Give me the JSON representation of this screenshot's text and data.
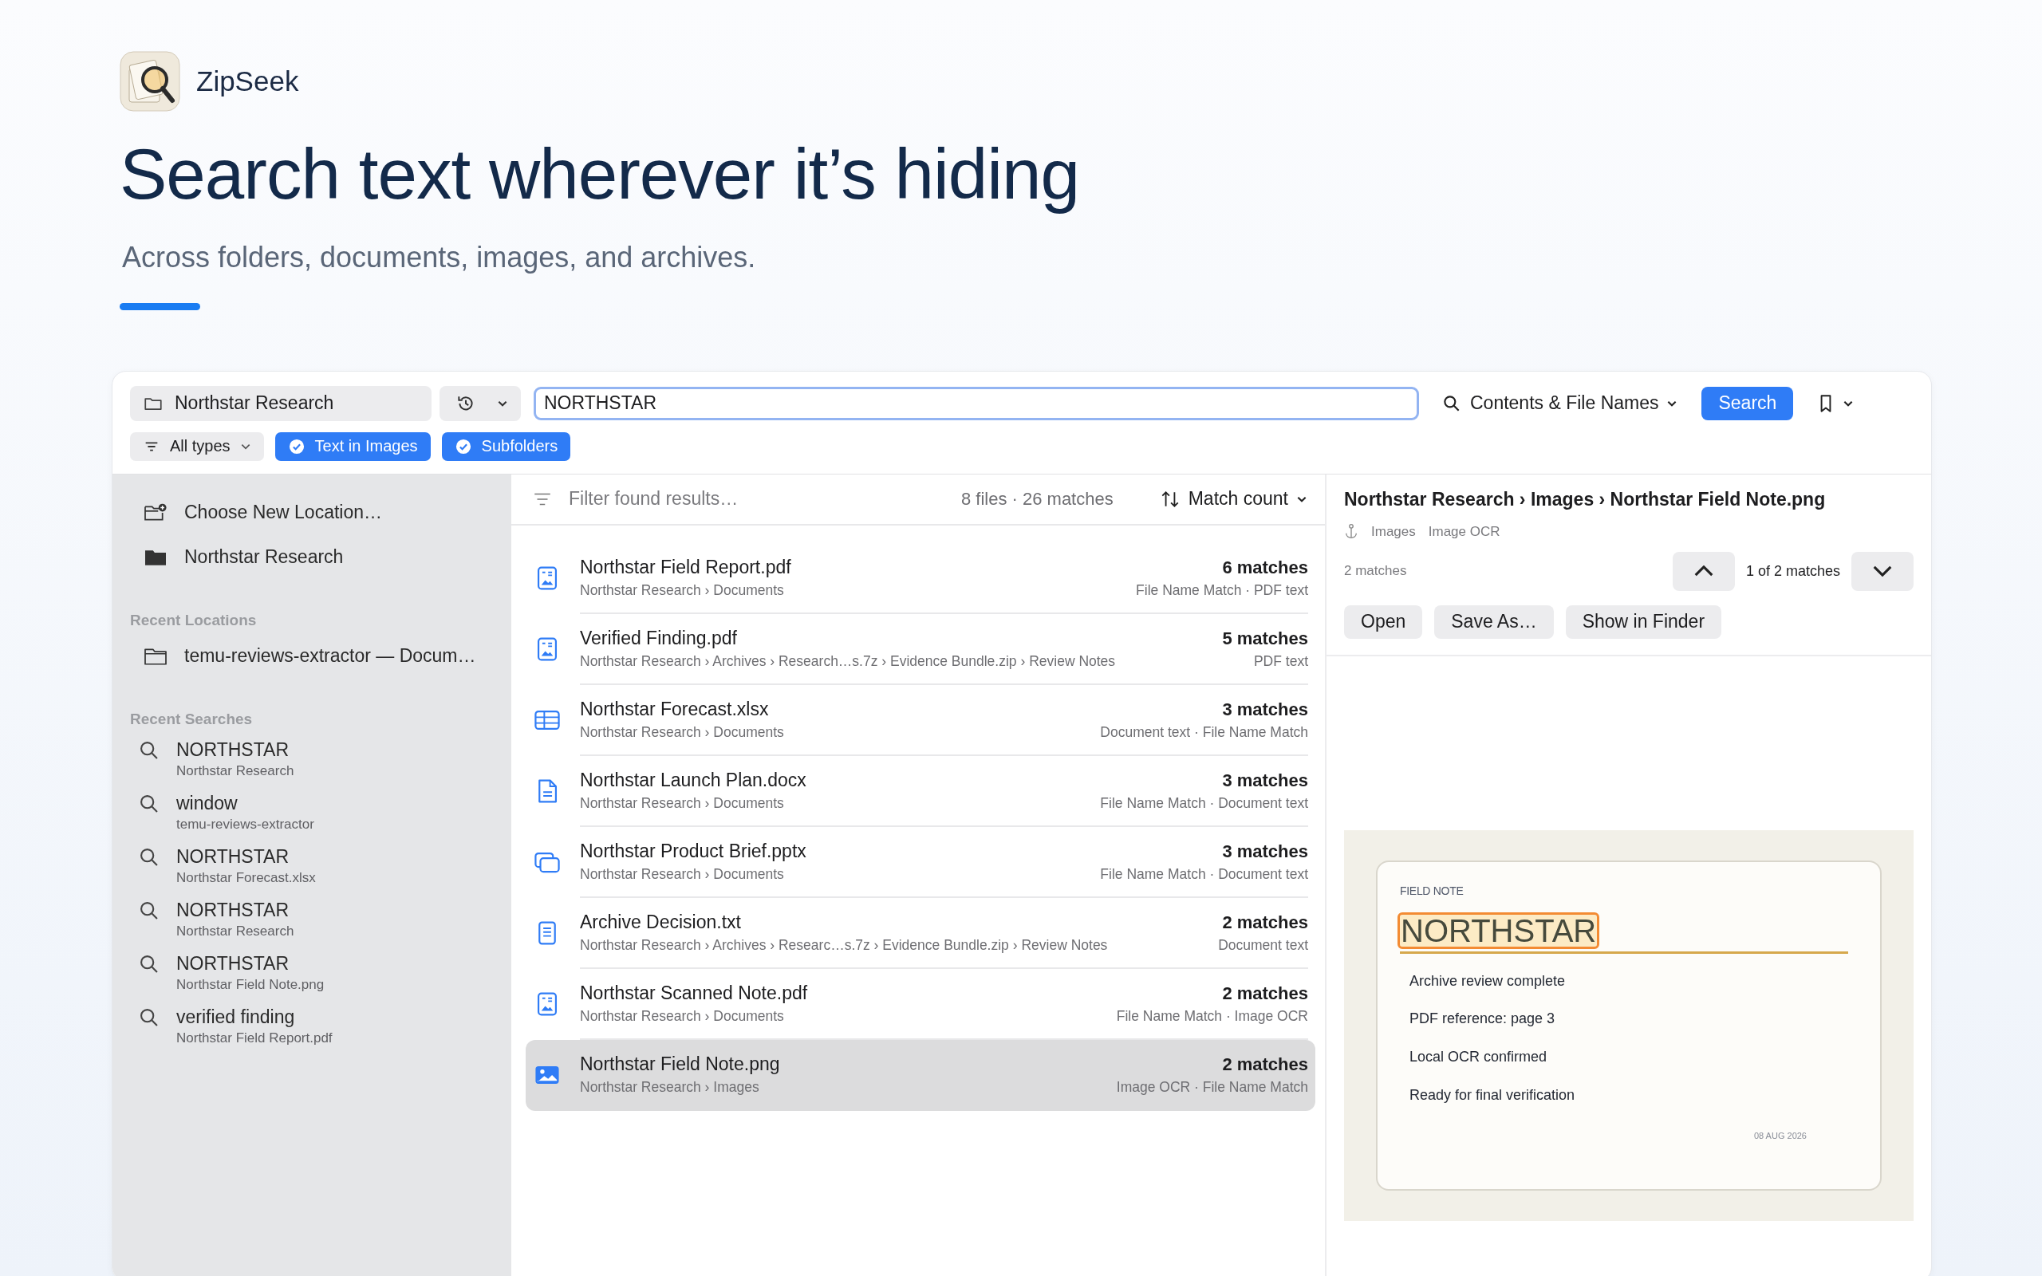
{
  "app": {
    "name": "ZipSeek"
  },
  "hero": {
    "headline": "Search text wherever it’s hiding",
    "subtitle": "Across folders, documents, images, and archives."
  },
  "toolbar": {
    "location": "Northstar Research",
    "search": {
      "value": "NORTHSTAR"
    },
    "search_mode": "Contents & File Names",
    "search_button": "Search",
    "type_filter": "All types",
    "toggles": [
      {
        "label": "Text in Images",
        "on": true
      },
      {
        "label": "Subfolders",
        "on": true
      }
    ]
  },
  "sidebar": {
    "actions": [
      {
        "kind": "new-location",
        "label": "Choose New Location…"
      },
      {
        "kind": "folder",
        "label": "Northstar Research"
      }
    ],
    "recent_locations": {
      "title": "Recent Locations",
      "items": [
        "temu-reviews-extractor — Docum…"
      ]
    },
    "recent_searches": {
      "title": "Recent Searches",
      "items": [
        {
          "query": "NORTHSTAR",
          "scope": "Northstar Research"
        },
        {
          "query": "window",
          "scope": "temu-reviews-extractor"
        },
        {
          "query": "NORTHSTAR",
          "scope": "Northstar Forecast.xlsx"
        },
        {
          "query": "NORTHSTAR",
          "scope": "Northstar Research"
        },
        {
          "query": "NORTHSTAR",
          "scope": "Northstar Field Note.png"
        },
        {
          "query": "verified finding",
          "scope": "Northstar Field Report.pdf"
        }
      ]
    }
  },
  "results": {
    "filter_placeholder": "Filter found results…",
    "summary": "8 files · 26 matches",
    "sort": "Match count",
    "rows": [
      {
        "kind": "pdf",
        "name": "Northstar Field Report.pdf",
        "path": "Northstar Research › Documents",
        "matches": "6 matches",
        "sources": "File Name Match · PDF text",
        "selected": false
      },
      {
        "kind": "pdf",
        "name": "Verified Finding.pdf",
        "path": "Northstar Research › Archives › Research…s.7z › Evidence Bundle.zip › Review Notes",
        "matches": "5 matches",
        "sources": "PDF text",
        "selected": false
      },
      {
        "kind": "spreadsheet",
        "name": "Northstar Forecast.xlsx",
        "path": "Northstar Research › Documents",
        "matches": "3 matches",
        "sources": "Document text · File Name Match",
        "selected": false
      },
      {
        "kind": "document",
        "name": "Northstar Launch Plan.docx",
        "path": "Northstar Research › Documents",
        "matches": "3 matches",
        "sources": "File Name Match · Document text",
        "selected": false
      },
      {
        "kind": "presentation",
        "name": "Northstar Product Brief.pptx",
        "path": "Northstar Research › Documents",
        "matches": "3 matches",
        "sources": "File Name Match · Document text",
        "selected": false
      },
      {
        "kind": "text",
        "name": "Archive Decision.txt",
        "path": "Northstar Research › Archives › Researc…s.7z › Evidence Bundle.zip › Review Notes",
        "matches": "2 matches",
        "sources": "Document text",
        "selected": false
      },
      {
        "kind": "pdf",
        "name": "Northstar Scanned Note.pdf",
        "path": "Northstar Research › Documents",
        "matches": "2 matches",
        "sources": "File Name Match · Image OCR",
        "selected": false
      },
      {
        "kind": "image",
        "name": "Northstar Field Note.png",
        "path": "Northstar Research › Images",
        "matches": "2 matches",
        "sources": "Image OCR · File Name Match",
        "selected": true
      }
    ]
  },
  "detail": {
    "breadcrumb": "Northstar Research › Images › Northstar Field Note.png",
    "tags": [
      "Images",
      "Image OCR"
    ],
    "match_count": "2 matches",
    "position": "1 of 2 matches",
    "actions": [
      "Open",
      "Save As…",
      "Show in Finder"
    ],
    "preview": {
      "label": "FIELD NOTE",
      "heading": "NORTHSTAR",
      "heading_highlighted": true,
      "lines": [
        "Archive review complete",
        "PDF reference: page 3",
        "Local OCR confirmed",
        "Ready for final verification"
      ],
      "date": "08 AUG 2026"
    }
  }
}
